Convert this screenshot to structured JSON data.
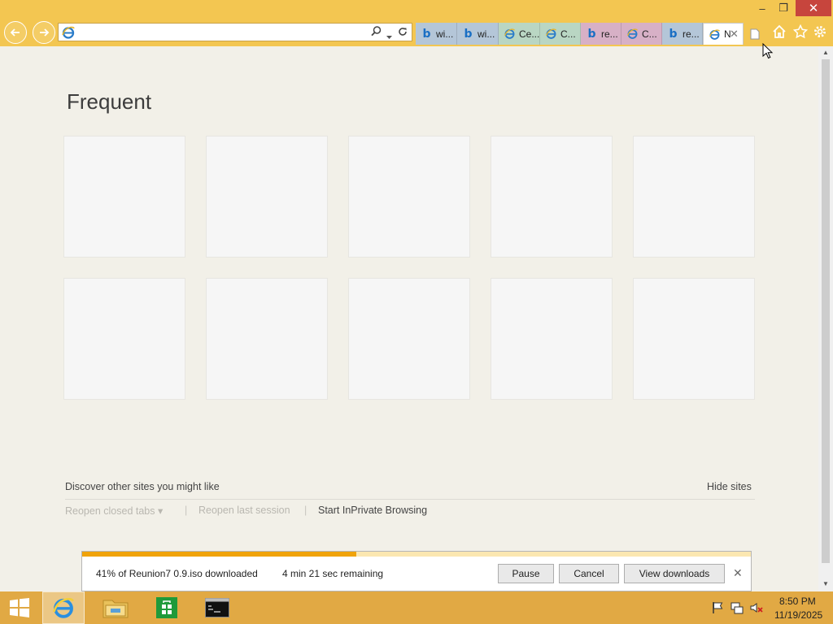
{
  "window": {
    "minimize_glyph": "–",
    "restore_glyph": "❐",
    "close_glyph": "✕"
  },
  "address_bar": {
    "value": "",
    "placeholder": ""
  },
  "tabs": [
    {
      "label": "wi...",
      "icon": "bing-icon",
      "color": "#b4c6d8"
    },
    {
      "label": "wi...",
      "icon": "bing-icon",
      "color": "#b4c6d8"
    },
    {
      "label": "Ce...",
      "icon": "ie-icon",
      "color": "#b9d6c3"
    },
    {
      "label": "C...",
      "icon": "ie-icon",
      "color": "#b9d6c3"
    },
    {
      "label": "re...",
      "icon": "bing-icon",
      "color": "#d7b0c6"
    },
    {
      "label": "C...",
      "icon": "ie-icon",
      "color": "#d7b0c6"
    },
    {
      "label": "re...",
      "icon": "bing-icon",
      "color": "#b4c6d8"
    },
    {
      "label": "N",
      "icon": "ie-icon",
      "color": "#ffffff",
      "active": true
    }
  ],
  "content": {
    "section_title": "Frequent",
    "tile_count": 10,
    "discover_text": "Discover other sites you might like",
    "hide_sites": "Hide sites",
    "reopen_closed_tabs": "Reopen closed tabs",
    "reopen_closed_arrow": "▾",
    "separator": "|",
    "reopen_last_session": "Reopen last session",
    "start_inprivate": "Start InPrivate Browsing"
  },
  "scrollbar": {
    "up_glyph": "▲",
    "down_glyph": "▼"
  },
  "download": {
    "status": "41% of Reunion7 0.9.iso downloaded",
    "remaining": "4 min 21 sec remaining",
    "progress_percent": 41,
    "pause_label": "Pause",
    "cancel_label": "Cancel",
    "view_downloads_label": "View downloads",
    "close_glyph": "✕"
  },
  "taskbar": {
    "time": "8:50 PM",
    "date": "11/19/2025"
  },
  "colors": {
    "titlebar": "#f3c651",
    "taskbar": "#e1a944",
    "close_button": "#c7453d",
    "progress_fill": "#f0a30a",
    "content_bg": "#f2f0e8"
  }
}
